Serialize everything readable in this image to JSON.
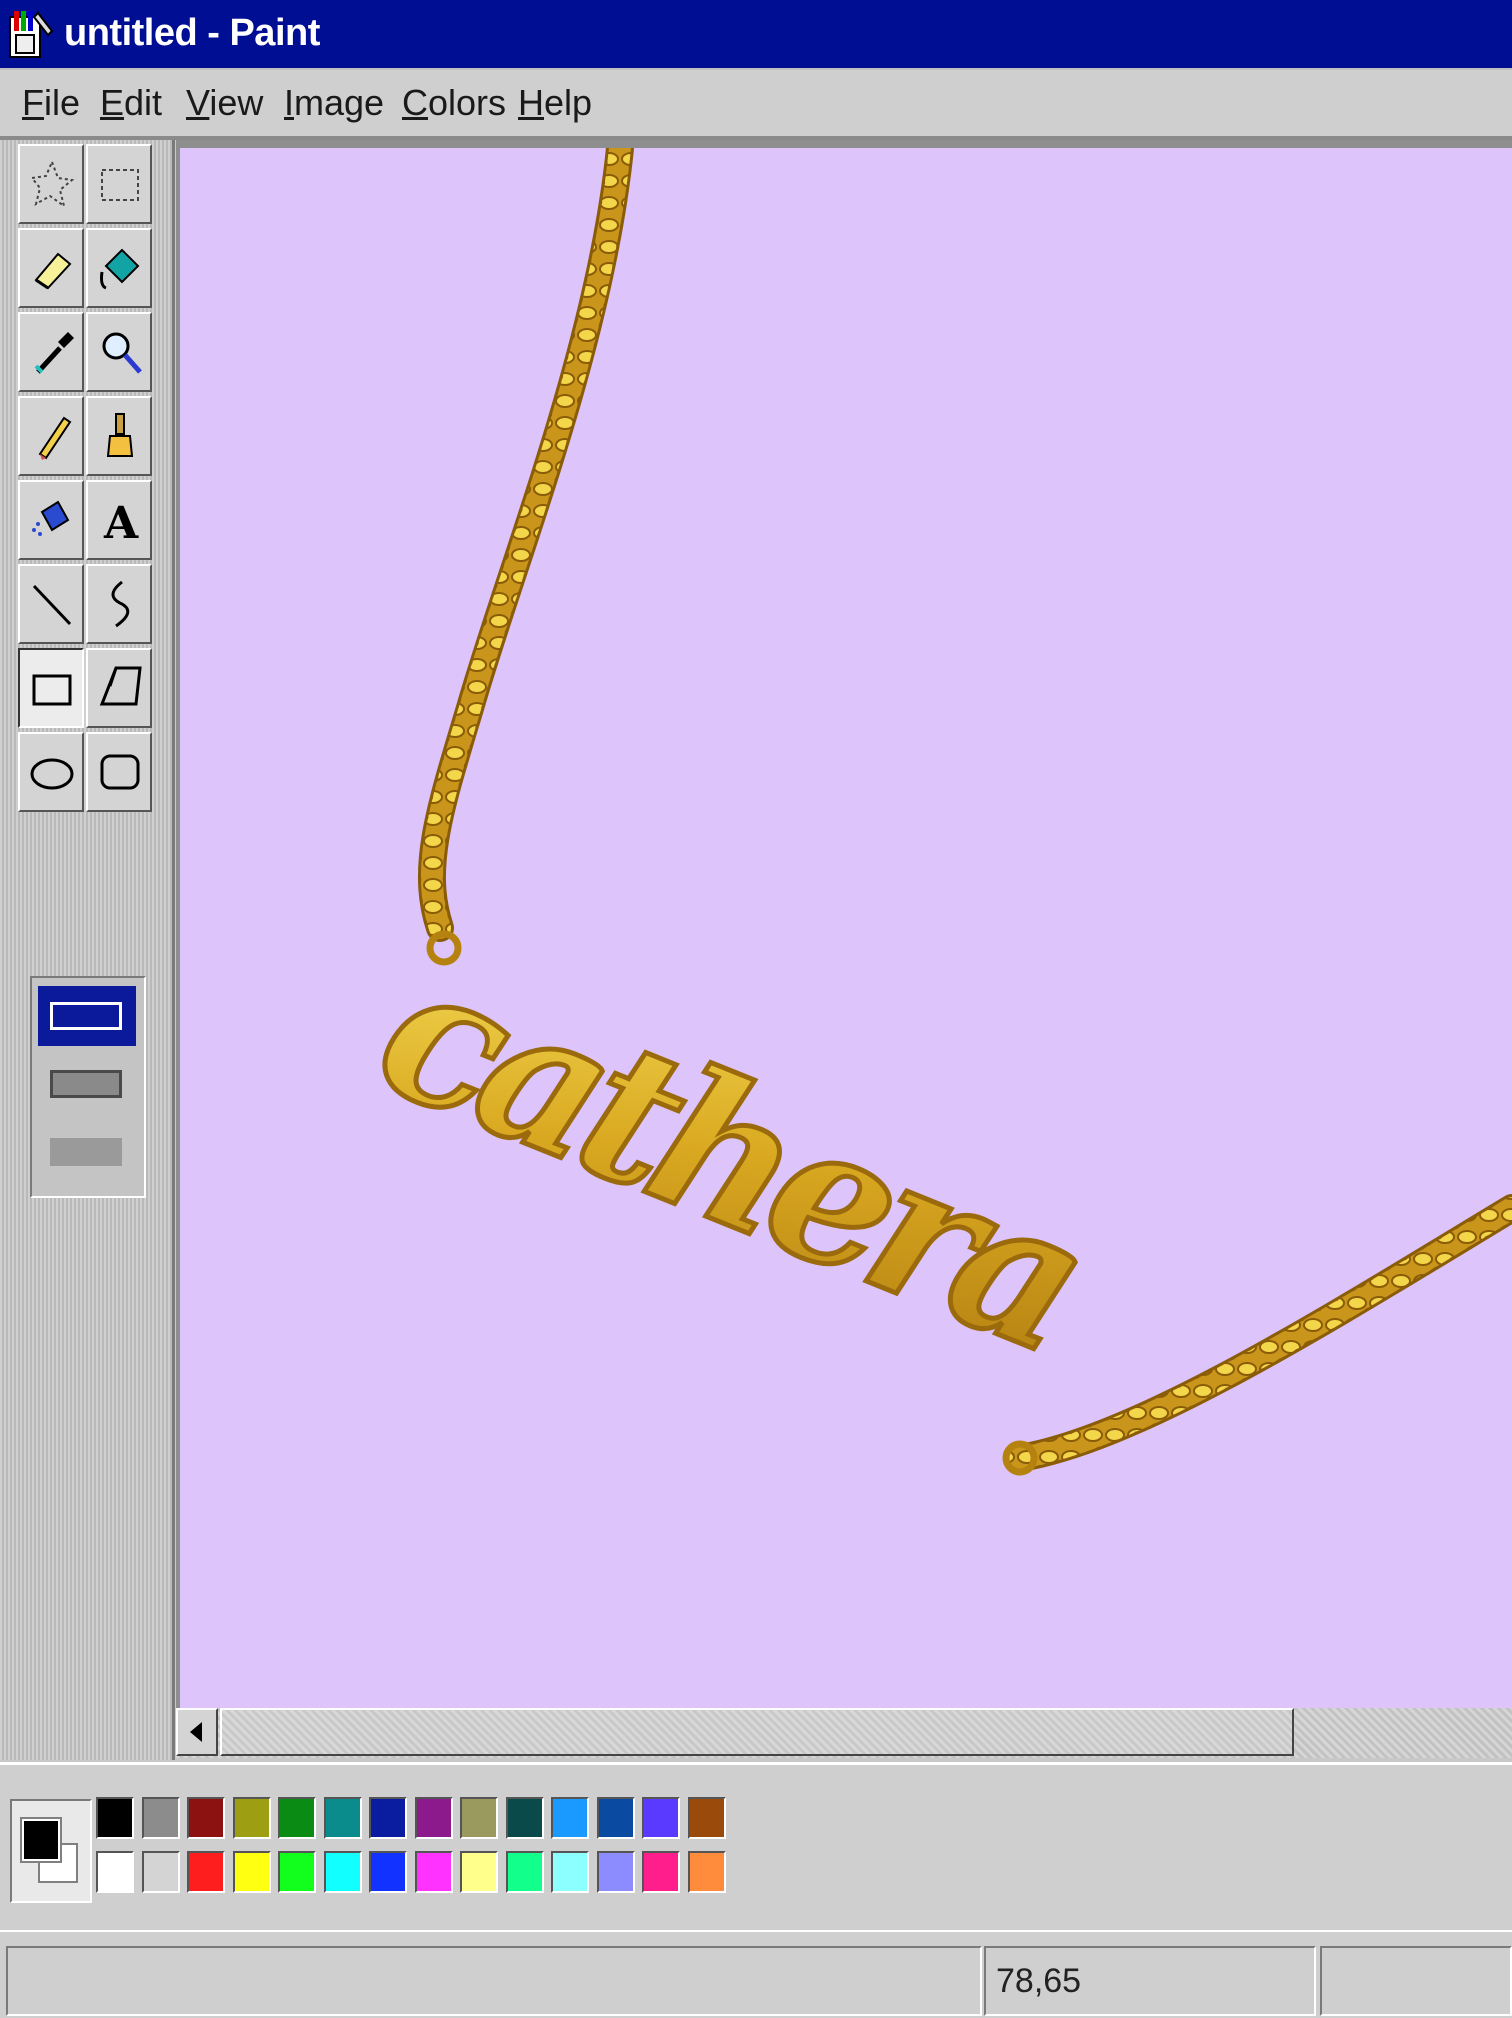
{
  "window": {
    "title": "untitled - Paint"
  },
  "menu": [
    {
      "label": "File",
      "mnemonic": "F"
    },
    {
      "label": "Edit",
      "mnemonic": "E"
    },
    {
      "label": "View",
      "mnemonic": "V"
    },
    {
      "label": "Image",
      "mnemonic": "I"
    },
    {
      "label": "Colors",
      "mnemonic": "C"
    },
    {
      "label": "Help",
      "mnemonic": "H"
    }
  ],
  "tools": [
    {
      "name": "free-form-select-icon"
    },
    {
      "name": "rect-select-icon"
    },
    {
      "name": "eraser-icon"
    },
    {
      "name": "fill-bucket-icon"
    },
    {
      "name": "color-picker-icon"
    },
    {
      "name": "magnifier-icon"
    },
    {
      "name": "pencil-icon"
    },
    {
      "name": "brush-icon"
    },
    {
      "name": "airbrush-icon"
    },
    {
      "name": "text-icon"
    },
    {
      "name": "line-icon"
    },
    {
      "name": "curve-icon"
    },
    {
      "name": "rectangle-icon"
    },
    {
      "name": "polygon-icon"
    },
    {
      "name": "ellipse-icon"
    },
    {
      "name": "rounded-rectangle-icon"
    }
  ],
  "active_tool": "rectangle-icon",
  "canvas": {
    "background": "#ddc4fb",
    "content": "gold name-script chain necklace",
    "necklace_text": "cathera"
  },
  "palette": {
    "foreground": "#000000",
    "background": "#ffffff",
    "top": [
      "#000000",
      "#8c8c8c",
      "#8c1212",
      "#9e9e12",
      "#0a8c14",
      "#0a8c8c",
      "#0a1ca0",
      "#8c1a8c",
      "#9a9a5e",
      "#0a4a4a",
      "#1a9aff",
      "#0a4aa0",
      "#5a3aff",
      "#9a4a0a"
    ],
    "bottom": [
      "#ffffff",
      "#d4d4d4",
      "#ff1e1e",
      "#ffff12",
      "#12ff1e",
      "#12ffff",
      "#1232ff",
      "#ff32ff",
      "#ffff8c",
      "#12ff8c",
      "#8cffff",
      "#8c8cff",
      "#ff1e8c",
      "#ff8c3c"
    ]
  },
  "status": {
    "coords": "78,65"
  }
}
